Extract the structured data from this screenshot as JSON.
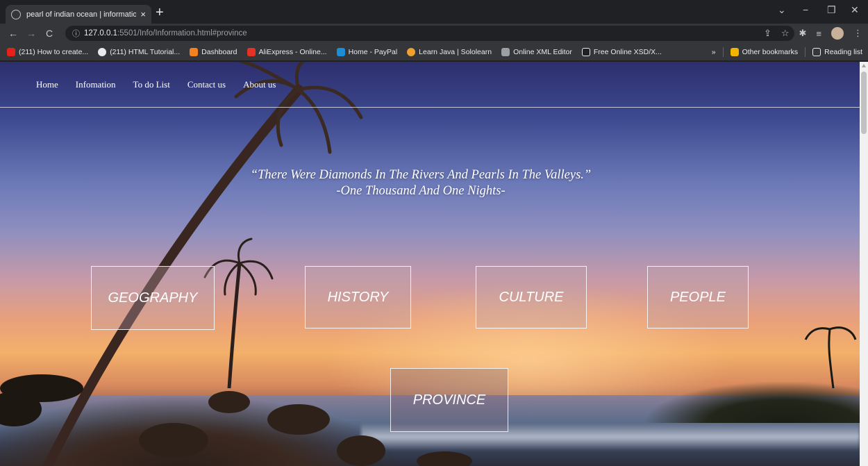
{
  "browser": {
    "tab_title": "pearl of indian ocean | informatio",
    "tab_close": "×",
    "new_tab": "+",
    "url_host": "127.0.0.1",
    "url_path": ":5501/Info/Information.html#province",
    "bookmarks": [
      {
        "label": "(211) How to create...",
        "color": "#e62117"
      },
      {
        "label": "(211) HTML Tutorial...",
        "color": "#e8eaed"
      },
      {
        "label": "Dashboard",
        "color": "#f58220"
      },
      {
        "label": "AliExpress - Online...",
        "color": "#e43225"
      },
      {
        "label": "Home - PayPal",
        "color": "#1a8fd8"
      },
      {
        "label": "Learn Java | Sololearn",
        "color": "#f0a02c"
      },
      {
        "label": "Online XML Editor",
        "color": "#9aa0a6"
      },
      {
        "label": "Free Online XSD/X...",
        "color": "#e8eaed"
      }
    ],
    "bookmarks_overflow": "»",
    "other_bookmarks": "Other bookmarks",
    "reading_list": "Reading list"
  },
  "site": {
    "nav": {
      "home": "Home",
      "information": "Infomation",
      "todo": "To do List",
      "contact": "Contact us",
      "about": "About us"
    },
    "quote_line1": "“There Were Diamonds In The Rivers And Pearls In The Valleys.”",
    "quote_line2": "-One Thousand And One Nights-",
    "categories": {
      "geography": "GEOGRAPHY",
      "history": "HISTORY",
      "culture": "CULTURE",
      "people": "PEOPLE",
      "province": "PROVINCE"
    }
  }
}
